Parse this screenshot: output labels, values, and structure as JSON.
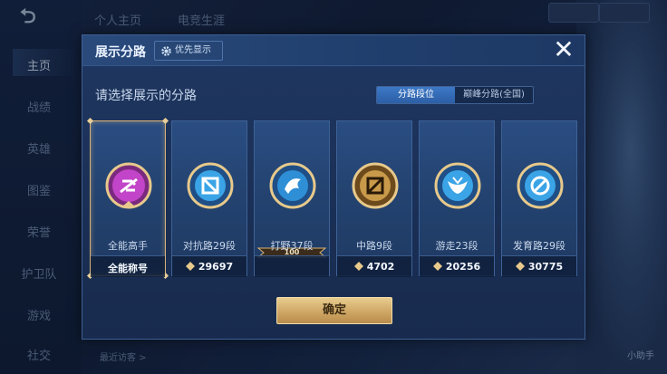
{
  "background": {
    "top_tabs": [
      "个人主页",
      "电竞生涯"
    ],
    "sidebar_items": [
      "主页",
      "战绩",
      "英雄",
      "图鉴",
      "荣誉",
      "护卫队",
      "游戏",
      "社交"
    ],
    "active_sidebar_index": 0,
    "bottom_text": "最近访客 >",
    "bottom_right_text": "小助手"
  },
  "dialog": {
    "title": "展示分路",
    "priority_label": "优先显示",
    "subtitle": "请选择展示的分路",
    "toggle": {
      "options": [
        "分路段位",
        "巅峰分路(全国)"
      ],
      "active_index": 0
    },
    "confirm_label": "确定",
    "lanes": [
      {
        "label": "全能高手",
        "footer": "全能称号",
        "selected": true,
        "color": "#c244c8"
      },
      {
        "label": "对抗路29段",
        "score": "29697",
        "color": "#3aa4e6"
      },
      {
        "label": "打野37段",
        "score": "",
        "rank_badge": "100",
        "color": "#2f8fd6"
      },
      {
        "label": "中路9段",
        "score": "4702",
        "color": "#c89a4a"
      },
      {
        "label": "游走23段",
        "score": "20256",
        "color": "#3aa4e6"
      },
      {
        "label": "发育路29段",
        "score": "30775",
        "color": "#3aa4e6"
      }
    ]
  },
  "colors": {
    "accent_gold": "#d7b277",
    "panel_blue": "#23426f",
    "toggle_active": "#3d78c6"
  }
}
